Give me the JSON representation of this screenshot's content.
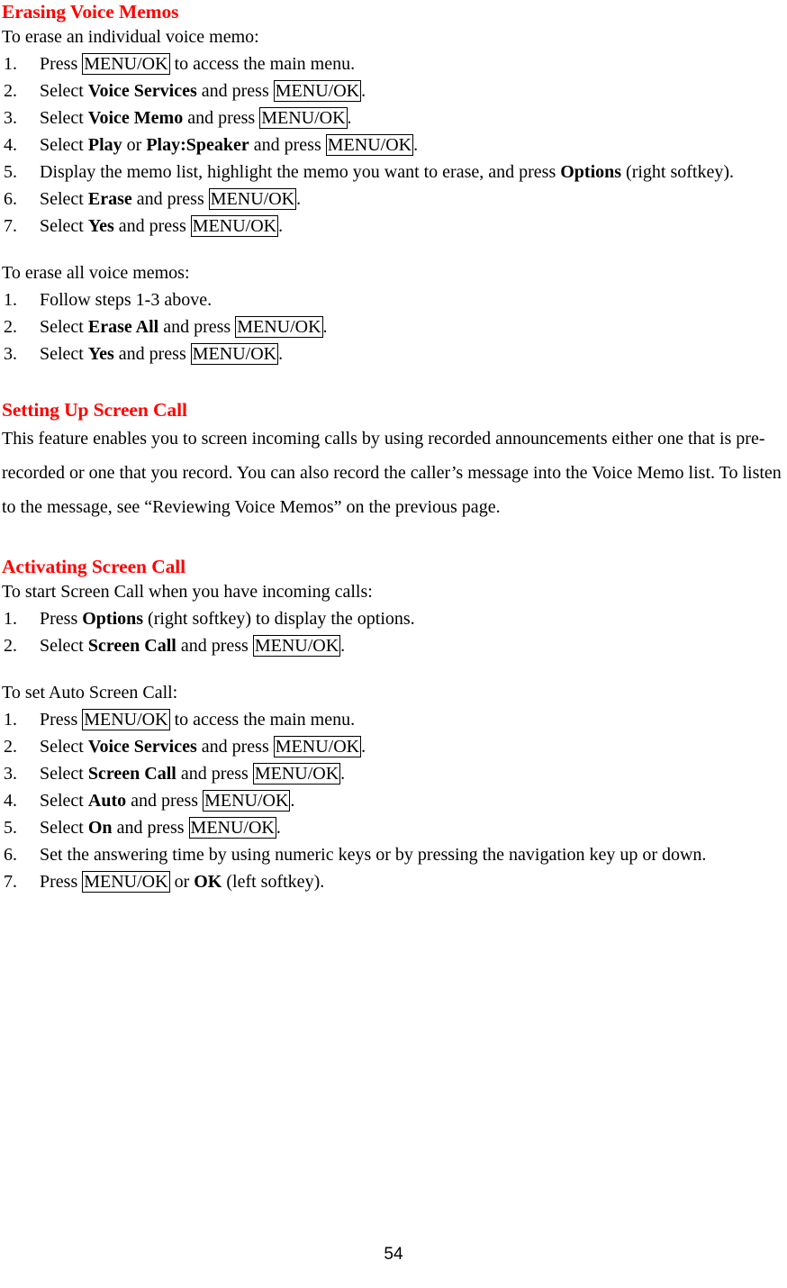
{
  "page": {
    "number": "54",
    "heading_color": "#ff0000",
    "text_color": "#000000",
    "background": "#ffffff"
  },
  "sections": [
    {
      "id": "erasing-voice-memos",
      "heading": "Erasing Voice Memos",
      "blocks": [
        {
          "type": "intro",
          "text": "To erase an individual voice memo:"
        },
        {
          "type": "list",
          "items": [
            {
              "num": "1.",
              "parts": [
                {
                  "t": "plain",
                  "v": "Press "
                },
                {
                  "t": "key",
                  "v": "MENU/OK"
                },
                {
                  "t": "plain",
                  "v": " to access the main menu."
                }
              ]
            },
            {
              "num": "2.",
              "parts": [
                {
                  "t": "plain",
                  "v": "Select "
                },
                {
                  "t": "bold",
                  "v": "Voice Services"
                },
                {
                  "t": "plain",
                  "v": " and press "
                },
                {
                  "t": "key",
                  "v": "MENU/OK"
                },
                {
                  "t": "plain",
                  "v": "."
                }
              ]
            },
            {
              "num": "3.",
              "parts": [
                {
                  "t": "plain",
                  "v": "Select "
                },
                {
                  "t": "bold",
                  "v": "Voice Memo"
                },
                {
                  "t": "plain",
                  "v": " and press "
                },
                {
                  "t": "key",
                  "v": "MENU/OK"
                },
                {
                  "t": "plain",
                  "v": "."
                }
              ]
            },
            {
              "num": "4.",
              "parts": [
                {
                  "t": "plain",
                  "v": "Select "
                },
                {
                  "t": "bold",
                  "v": "Play"
                },
                {
                  "t": "plain",
                  "v": " or "
                },
                {
                  "t": "bold",
                  "v": "Play:Speaker"
                },
                {
                  "t": "plain",
                  "v": " and press "
                },
                {
                  "t": "key",
                  "v": "MENU/OK"
                },
                {
                  "t": "plain",
                  "v": "."
                }
              ]
            },
            {
              "num": "5.",
              "parts": [
                {
                  "t": "plain",
                  "v": "Display the memo list, highlight the memo you want to erase, and press "
                },
                {
                  "t": "bold",
                  "v": "Options"
                },
                {
                  "t": "plain",
                  "v": " (right softkey)."
                }
              ]
            },
            {
              "num": "6.",
              "parts": [
                {
                  "t": "plain",
                  "v": "Select "
                },
                {
                  "t": "bold",
                  "v": "Erase"
                },
                {
                  "t": "plain",
                  "v": " and press "
                },
                {
                  "t": "key",
                  "v": "MENU/OK"
                },
                {
                  "t": "plain",
                  "v": "."
                }
              ]
            },
            {
              "num": "7.",
              "parts": [
                {
                  "t": "plain",
                  "v": "Select "
                },
                {
                  "t": "bold",
                  "v": "Yes"
                },
                {
                  "t": "plain",
                  "v": " and press "
                },
                {
                  "t": "key",
                  "v": "MENU/OK"
                },
                {
                  "t": "plain",
                  "v": "."
                }
              ]
            }
          ]
        },
        {
          "type": "intro",
          "text": "To erase all voice memos:"
        },
        {
          "type": "list",
          "items": [
            {
              "num": "1.",
              "parts": [
                {
                  "t": "plain",
                  "v": "Follow steps 1-3 above."
                }
              ]
            },
            {
              "num": "2.",
              "parts": [
                {
                  "t": "plain",
                  "v": "Select "
                },
                {
                  "t": "bold",
                  "v": "Erase All"
                },
                {
                  "t": "plain",
                  "v": " and press "
                },
                {
                  "t": "key",
                  "v": "MENU/OK"
                },
                {
                  "t": "plain",
                  "v": "."
                }
              ]
            },
            {
              "num": "3.",
              "parts": [
                {
                  "t": "plain",
                  "v": "Select "
                },
                {
                  "t": "bold",
                  "v": "Yes"
                },
                {
                  "t": "plain",
                  "v": " and press "
                },
                {
                  "t": "key",
                  "v": "MENU/OK"
                },
                {
                  "t": "plain",
                  "v": "."
                }
              ]
            }
          ]
        }
      ]
    },
    {
      "id": "setting-up-screen-call",
      "heading": "Setting Up Screen Call",
      "blocks": [
        {
          "type": "paragraph",
          "text": "This feature enables you to screen incoming calls by using recorded announcements either one that is pre-recorded or one that you record. You can also record the caller’s message into the Voice Memo list. To listen to the message, see “Reviewing Voice Memos” on the previous page."
        }
      ]
    },
    {
      "id": "activating-screen-call",
      "heading": "Activating Screen Call",
      "blocks": [
        {
          "type": "intro",
          "text": "To start Screen Call when you have incoming calls:"
        },
        {
          "type": "list",
          "items": [
            {
              "num": "1.",
              "parts": [
                {
                  "t": "plain",
                  "v": "Press "
                },
                {
                  "t": "bold",
                  "v": "Options"
                },
                {
                  "t": "plain",
                  "v": " (right softkey) to display the options."
                }
              ]
            },
            {
              "num": "2.",
              "parts": [
                {
                  "t": "plain",
                  "v": "Select "
                },
                {
                  "t": "bold",
                  "v": "Screen Call"
                },
                {
                  "t": "plain",
                  "v": " and press "
                },
                {
                  "t": "key",
                  "v": "MENU/OK"
                },
                {
                  "t": "plain",
                  "v": "."
                }
              ]
            }
          ]
        },
        {
          "type": "intro",
          "text": "To set Auto Screen Call:"
        },
        {
          "type": "list",
          "items": [
            {
              "num": "1.",
              "parts": [
                {
                  "t": "plain",
                  "v": "Press "
                },
                {
                  "t": "key",
                  "v": "MENU/OK"
                },
                {
                  "t": "plain",
                  "v": " to access the main menu."
                }
              ]
            },
            {
              "num": "2.",
              "parts": [
                {
                  "t": "plain",
                  "v": "Select "
                },
                {
                  "t": "bold",
                  "v": "Voice Services"
                },
                {
                  "t": "plain",
                  "v": " and press "
                },
                {
                  "t": "key",
                  "v": "MENU/OK"
                },
                {
                  "t": "plain",
                  "v": "."
                }
              ]
            },
            {
              "num": "3.",
              "parts": [
                {
                  "t": "plain",
                  "v": "Select "
                },
                {
                  "t": "bold",
                  "v": "Screen Call"
                },
                {
                  "t": "plain",
                  "v": " and press "
                },
                {
                  "t": "key",
                  "v": "MENU/OK"
                },
                {
                  "t": "plain",
                  "v": "."
                }
              ]
            },
            {
              "num": "4.",
              "parts": [
                {
                  "t": "plain",
                  "v": "Select "
                },
                {
                  "t": "bold",
                  "v": "Auto"
                },
                {
                  "t": "plain",
                  "v": " and press "
                },
                {
                  "t": "key",
                  "v": "MENU/OK"
                },
                {
                  "t": "plain",
                  "v": "."
                }
              ]
            },
            {
              "num": "5.",
              "parts": [
                {
                  "t": "plain",
                  "v": "Select "
                },
                {
                  "t": "bold",
                  "v": "On"
                },
                {
                  "t": "plain",
                  "v": " and press "
                },
                {
                  "t": "key",
                  "v": "MENU/OK"
                },
                {
                  "t": "plain",
                  "v": "."
                }
              ]
            },
            {
              "num": "6.",
              "parts": [
                {
                  "t": "plain",
                  "v": "Set the answering time by using numeric keys or by pressing the navigation key up or down."
                }
              ]
            },
            {
              "num": "7.",
              "parts": [
                {
                  "t": "plain",
                  "v": "Press "
                },
                {
                  "t": "key",
                  "v": "MENU/OK"
                },
                {
                  "t": "plain",
                  "v": " or "
                },
                {
                  "t": "bold",
                  "v": "OK"
                },
                {
                  "t": "plain",
                  "v": " (left softkey)."
                }
              ]
            }
          ]
        }
      ]
    }
  ]
}
